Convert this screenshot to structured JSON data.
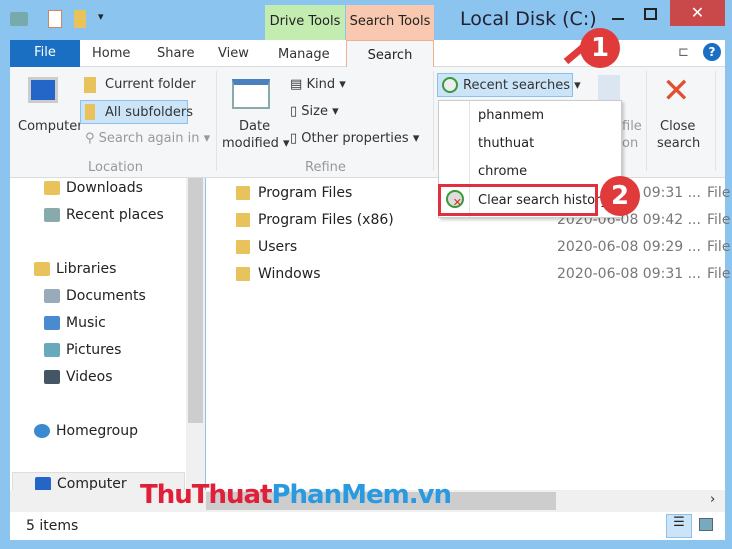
{
  "window": {
    "title": "Local Disk (C:)",
    "context_tabs": [
      "Drive Tools",
      "Search Tools"
    ]
  },
  "tabs": {
    "file": "File",
    "home": "Home",
    "share": "Share",
    "view": "View",
    "manage": "Manage",
    "search": "Search"
  },
  "ribbon": {
    "computer": "Computer",
    "current_folder": "Current folder",
    "all_subfolders": "All subfolders",
    "search_again": "Search again in",
    "location_group": "Location",
    "date_modified_1": "Date",
    "date_modified_2": "modified",
    "kind": "Kind",
    "size": "Size",
    "other_properties": "Other properties",
    "refine_group": "Refine",
    "recent_searches": "Recent searches",
    "open_file_1": "file",
    "open_file_2": "on",
    "close_search_1": "Close",
    "close_search_2": "search"
  },
  "recent_menu": {
    "items": [
      "phanmem",
      "thuthuat",
      "chrome"
    ],
    "clear": "Clear search history"
  },
  "annotations": {
    "step1": "1",
    "step2": "2"
  },
  "nav": {
    "items": [
      "Downloads",
      "Recent places",
      "Libraries",
      "Documents",
      "Music",
      "Pictures",
      "Videos",
      "Homegroup",
      "Computer"
    ]
  },
  "files": [
    {
      "name": "Program Files",
      "date": "2020-06-08 09:31 ...",
      "type": "File"
    },
    {
      "name": "Program Files (x86)",
      "date": "2020-06-08 09:42 ...",
      "type": "File"
    },
    {
      "name": "Users",
      "date": "2020-06-08 09:29 ...",
      "type": "File"
    },
    {
      "name": "Windows",
      "date": "2020-06-08 09:31 ...",
      "type": "File"
    }
  ],
  "status": {
    "items": "5 items"
  },
  "watermark": {
    "part1": "ThuThuat",
    "part2": "PhanMem.vn"
  },
  "colors": {
    "file_tab": "#1a6fc3",
    "drive_tools": "#c3ecb0",
    "search_tools": "#f8c8b0",
    "highlight": "#e03040",
    "close_btn": "#c9484a"
  }
}
